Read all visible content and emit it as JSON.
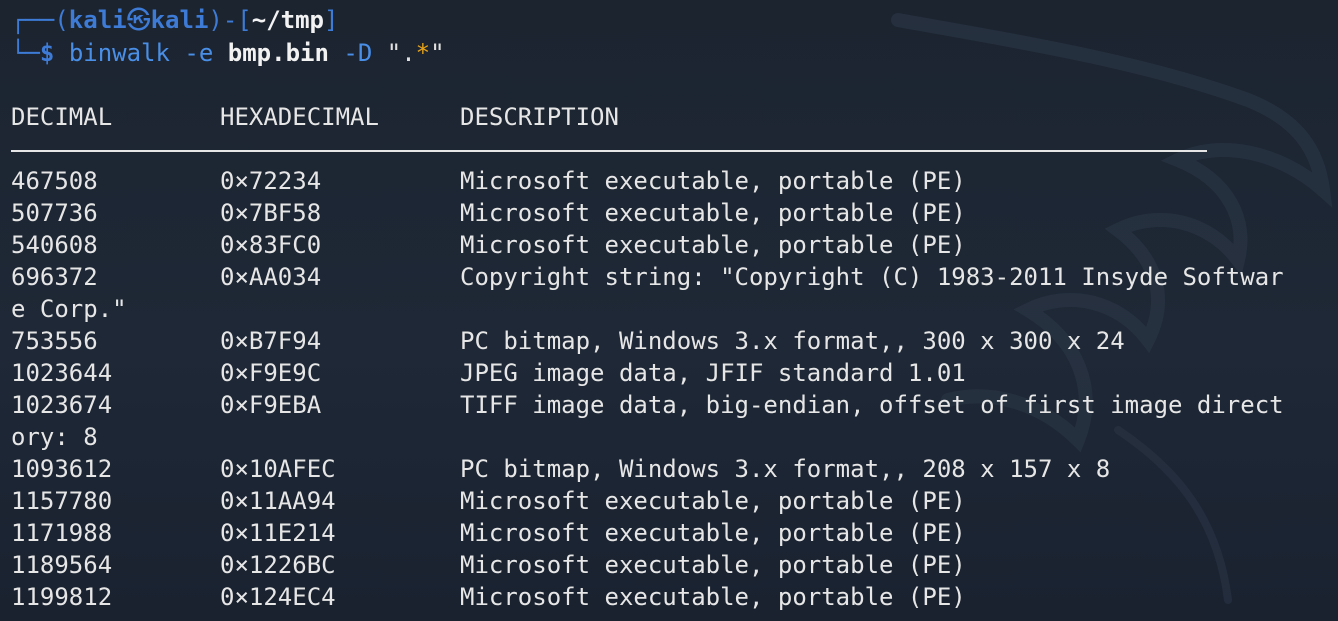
{
  "prompt": {
    "corner_top": "┌──(",
    "user": "kali",
    "at_symbol": "㉿",
    "host": "kali",
    "mid": ")-[",
    "dir": "~/tmp",
    "close": "]",
    "corner_bottom": "└─",
    "dollar": "$"
  },
  "command": {
    "program": "binwalk",
    "flag1": "-e",
    "file": "bmp.bin",
    "flag2": "-D",
    "quote_open": "\".",
    "star": "*",
    "quote_close": "\""
  },
  "table": {
    "headers": [
      "DECIMAL",
      "HEXADECIMAL",
      "DESCRIPTION"
    ],
    "rows": [
      {
        "decimal": "467508",
        "hex": "0×72234",
        "desc": "Microsoft executable, portable (PE)"
      },
      {
        "decimal": "507736",
        "hex": "0×7BF58",
        "desc": "Microsoft executable, portable (PE)"
      },
      {
        "decimal": "540608",
        "hex": "0×83FC0",
        "desc": "Microsoft executable, portable (PE)"
      },
      {
        "decimal": "696372",
        "hex": "0×AA034",
        "desc": "Copyright string: \"Copyright (C) 1983-2011 Insyde Softwar",
        "wrap": "e Corp.\""
      },
      {
        "decimal": "753556",
        "hex": "0×B7F94",
        "desc": "PC bitmap, Windows 3.x format,, 300 x 300 x 24"
      },
      {
        "decimal": "1023644",
        "hex": "0×F9E9C",
        "desc": "JPEG image data, JFIF standard 1.01"
      },
      {
        "decimal": "1023674",
        "hex": "0×F9EBA",
        "desc": "TIFF image data, big-endian, offset of first image direct",
        "wrap": "ory: 8"
      },
      {
        "decimal": "1093612",
        "hex": "0×10AFEC",
        "desc": "PC bitmap, Windows 3.x format,, 208 x 157 x 8"
      },
      {
        "decimal": "1157780",
        "hex": "0×11AA94",
        "desc": "Microsoft executable, portable (PE)"
      },
      {
        "decimal": "1171988",
        "hex": "0×11E214",
        "desc": "Microsoft executable, portable (PE)"
      },
      {
        "decimal": "1189564",
        "hex": "0×1226BC",
        "desc": "Microsoft executable, portable (PE)"
      },
      {
        "decimal": "1199812",
        "hex": "0×124EC4",
        "desc": "Microsoft executable, portable (PE)"
      }
    ]
  },
  "colors": {
    "background": "#1c2430",
    "prompt_blue": "#3d7bd6",
    "command_blue": "#4a8fe7",
    "star_orange": "#e8a317",
    "text": "#e6e6e6"
  }
}
